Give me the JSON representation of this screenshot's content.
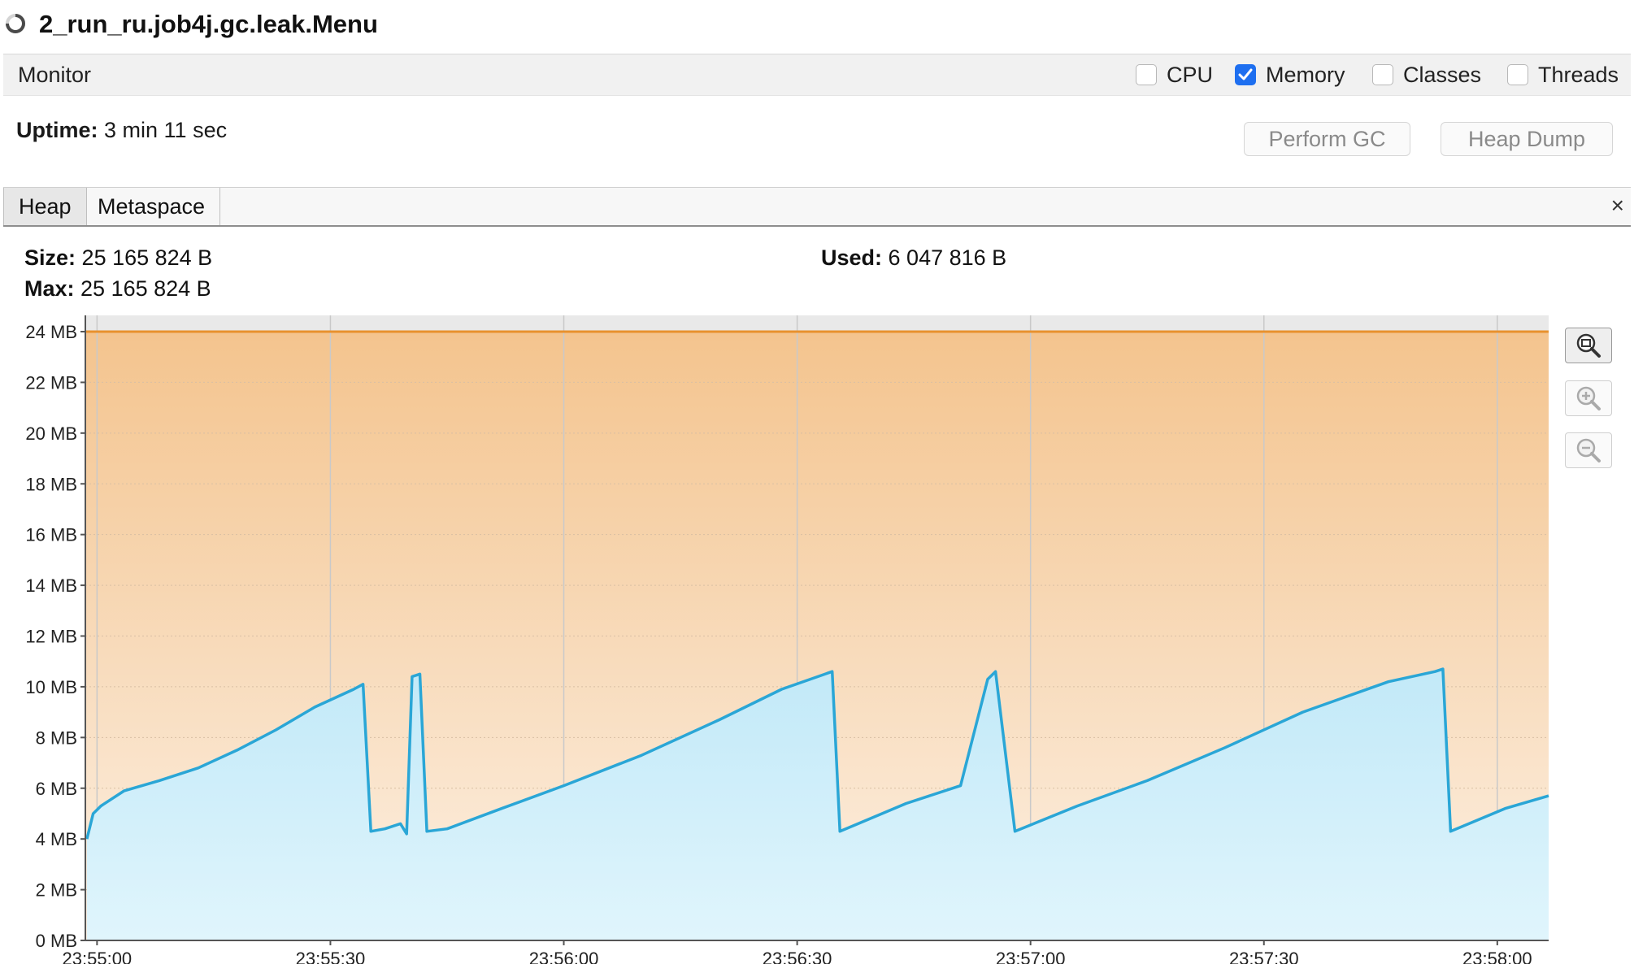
{
  "window": {
    "title": "2_run_ru.job4j.gc.leak.Menu"
  },
  "monitor": {
    "label": "Monitor",
    "checkboxes": [
      {
        "label": "CPU",
        "checked": false
      },
      {
        "label": "Memory",
        "checked": true
      },
      {
        "label": "Classes",
        "checked": false
      },
      {
        "label": "Threads",
        "checked": false
      }
    ]
  },
  "uptime": {
    "label": "Uptime:",
    "value": "3 min 11 sec"
  },
  "buttons": {
    "perform_gc": "Perform GC",
    "heap_dump": "Heap Dump"
  },
  "tabs": [
    {
      "label": "Heap",
      "active": true
    },
    {
      "label": "Metaspace",
      "active": false
    }
  ],
  "close_glyph": "×",
  "heap": {
    "size_label": "Size:",
    "size_value": "25 165 824 B",
    "max_label": "Max:",
    "max_value": "25 165 824 B",
    "used_label": "Used:",
    "used_value": "6 047 816 B"
  },
  "colors": {
    "used_line": "#2aa6d6",
    "size_line": "#e8912e",
    "checkbox_accent": "#1e6ff0"
  },
  "icons": [
    "spinner-icon",
    "zoom-fit-icon",
    "zoom-in-icon",
    "zoom-out-icon"
  ],
  "chart_data": {
    "type": "area",
    "ylim": [
      0,
      24
    ],
    "yticks": [
      0,
      2,
      4,
      6,
      8,
      10,
      12,
      14,
      16,
      18,
      20,
      22,
      24
    ],
    "ytick_labels": [
      "0 MB",
      "2 MB",
      "4 MB",
      "6 MB",
      "8 MB",
      "10 MB",
      "12 MB",
      "14 MB",
      "16 MB",
      "18 MB",
      "20 MB",
      "22 MB",
      "24 MB"
    ],
    "xlim": [
      -1.5,
      186.6
    ],
    "xticks": [
      0,
      30,
      60,
      90,
      120,
      150,
      180
    ],
    "xtick_labels": [
      "23:55:00",
      "23:55:30",
      "23:56:00",
      "23:56:30",
      "23:57:00",
      "23:57:30",
      "23:58:00"
    ],
    "grid": true,
    "series": [
      {
        "name": "Heap size",
        "x": [
          -1.5,
          186.6
        ],
        "y": [
          24,
          24
        ]
      },
      {
        "name": "Used heap",
        "x": [
          -1.3,
          -0.5,
          0.5,
          3.5,
          8,
          13,
          18,
          23,
          28,
          33,
          34.2,
          35.2,
          37,
          39,
          39.8,
          40.5,
          41.5,
          42.4,
          45,
          52,
          60,
          70,
          80,
          88,
          94.5,
          95.5,
          104,
          111,
          114.5,
          115.5,
          118,
          126,
          135,
          145,
          155,
          166,
          172,
          173,
          174,
          181,
          186.6
        ],
        "y": [
          4.0,
          5.0,
          5.3,
          5.9,
          6.3,
          6.8,
          7.5,
          8.3,
          9.2,
          9.9,
          10.1,
          4.3,
          4.4,
          4.6,
          4.2,
          10.4,
          10.5,
          4.3,
          4.4,
          5.2,
          6.1,
          7.3,
          8.7,
          9.9,
          10.6,
          4.3,
          5.4,
          6.1,
          10.3,
          10.6,
          4.3,
          5.3,
          6.3,
          7.6,
          9.0,
          10.2,
          10.6,
          10.7,
          4.3,
          5.2,
          5.7
        ]
      }
    ]
  }
}
